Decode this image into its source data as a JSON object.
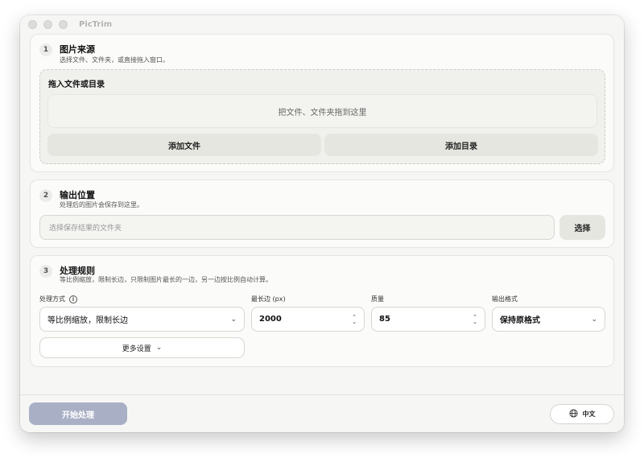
{
  "app": {
    "title": "PicTrim"
  },
  "source": {
    "step": "1",
    "title": "图片来源",
    "desc": "选择文件、文件夹，或直接拖入窗口。",
    "drop_title": "拖入文件或目录",
    "drop_hint": "把文件、文件夹拖到这里",
    "add_file": "添加文件",
    "add_dir": "添加目录"
  },
  "output": {
    "step": "2",
    "title": "输出位置",
    "desc": "处理后的图片会保存到这里。",
    "placeholder": "选择保存结果的文件夹",
    "choose": "选择"
  },
  "rules": {
    "step": "3",
    "title": "处理规则",
    "desc": "等比例缩放，限制长边，只限制图片最长的一边，另一边按比例自动计算。",
    "mode_label": "处理方式",
    "mode_value": "等比例缩放，限制长边",
    "max_label": "最长边 (px)",
    "max_value": "2000",
    "quality_label": "质量",
    "quality_value": "85",
    "format_label": "输出格式",
    "format_value": "保持原格式",
    "more": "更多设置"
  },
  "footer": {
    "start": "开始处理",
    "language": "中文"
  },
  "colors": {
    "primary_disabled": "#a9b0c6",
    "card_bg": "#fbfbfa",
    "window_bg": "#f6f6f4"
  }
}
